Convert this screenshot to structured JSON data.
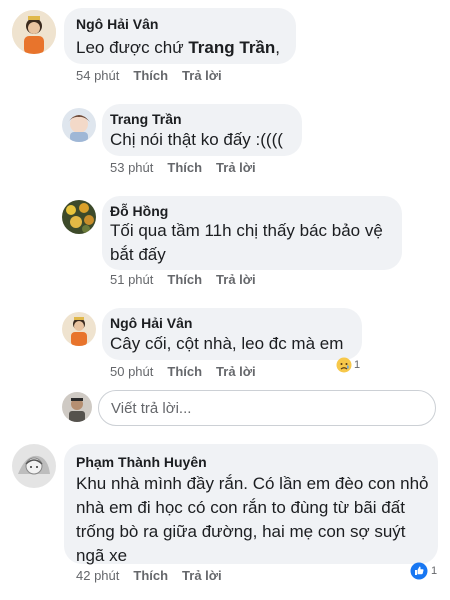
{
  "comments": [
    {
      "author": "Ngô Hải Vân",
      "text_before": "Leo được chứ ",
      "mention": "Trang Trần",
      "text_after": ",",
      "time": "54 phút",
      "like": "Thích",
      "reply": "Trả lời"
    },
    {
      "author": "Trang Trần",
      "text": "Chị nói thật ko đấy :((((",
      "time": "53 phút",
      "like": "Thích",
      "reply": "Trả lời"
    },
    {
      "author": "Đỗ Hồng",
      "text": "Tối qua tầm 11h chị thấy bác bảo vệ bắt đấy",
      "time": "51 phút",
      "like": "Thích",
      "reply": "Trả lời"
    },
    {
      "author": "Ngô Hải Vân",
      "text": "Cây cối, cột nhà, leo đc mà em",
      "time": "50 phút",
      "like": "Thích",
      "reply": "Trả lời",
      "reaction": {
        "icon": "sad-emoji-icon",
        "count": "1"
      }
    },
    {
      "author": "Phạm Thành Huyên",
      "text": "Khu nhà mình đầy rắn. Có lần em đèo con nhỏ nhà em đi học có con rắn to đùng từ bãi đất trống bò ra giữa đường, hai mẹ con sợ suýt ngã xe",
      "time": "42 phút",
      "like": "Thích",
      "reply": "Trả lời",
      "reaction": {
        "icon": "like-thumb-icon",
        "count": "1"
      }
    }
  ],
  "reply_input": {
    "placeholder": "Viết trả lời..."
  },
  "colors": {
    "bubble": "#f0f2f5",
    "meta": "#65676b",
    "like_blue": "#1877f2"
  }
}
